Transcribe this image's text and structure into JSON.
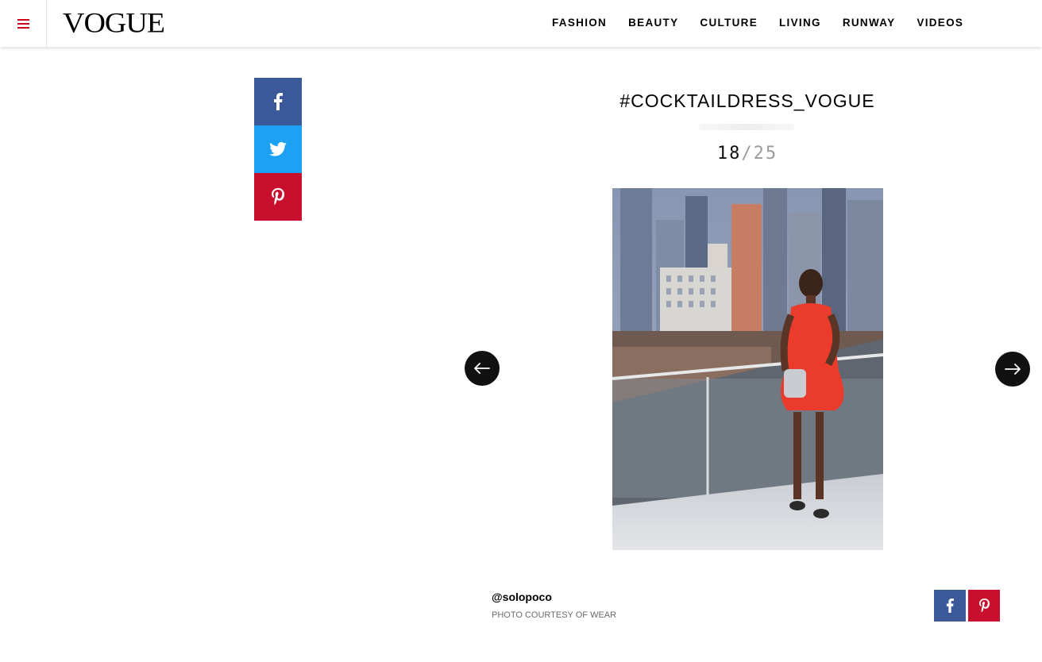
{
  "header": {
    "logo": "VOGUE",
    "nav": [
      "FASHION",
      "BEAUTY",
      "CULTURE",
      "LIVING",
      "RUNWAY",
      "VIDEOS"
    ]
  },
  "gallery": {
    "title": "#COCKTAILDRESS_VOGUE",
    "current": "18",
    "separator": "/",
    "total": "25"
  },
  "caption": {
    "handle": "@solopoco",
    "credit": "PHOTO COURTESY OF WEAR"
  },
  "colors": {
    "facebook": "#3b5998",
    "twitter": "#1da1f2",
    "pinterest": "#c8102e",
    "accent": "#d0021b"
  },
  "icons": [
    "menu-icon",
    "facebook-icon",
    "twitter-icon",
    "pinterest-icon",
    "arrow-left-icon",
    "arrow-right-icon"
  ]
}
